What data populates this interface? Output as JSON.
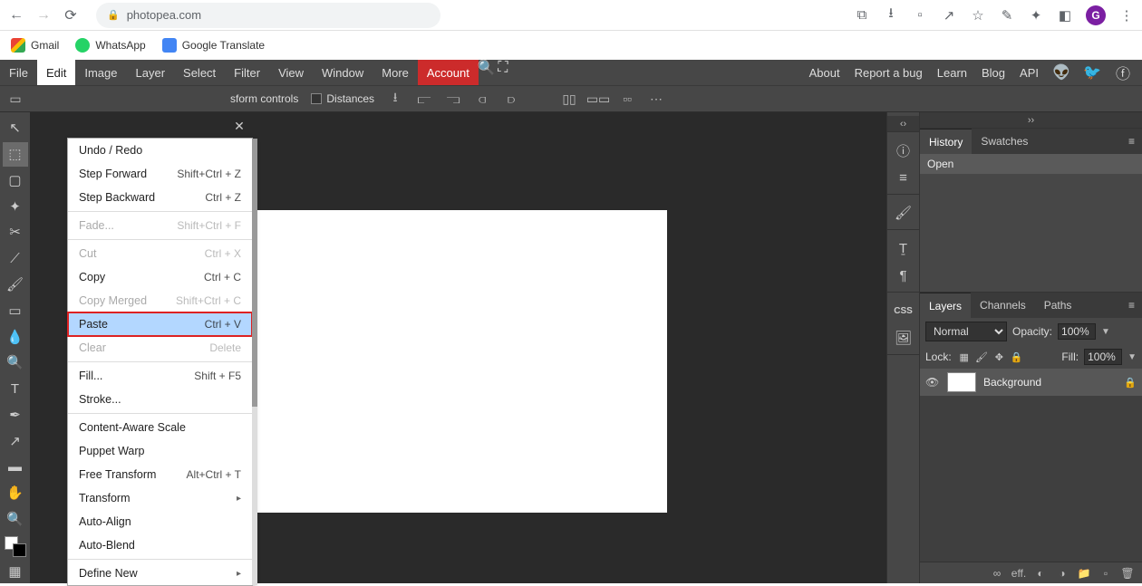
{
  "browser": {
    "url": "photopea.com",
    "avatar_letter": "G",
    "bookmarks": [
      {
        "label": "Gmail"
      },
      {
        "label": "WhatsApp"
      },
      {
        "label": "Google Translate"
      }
    ]
  },
  "menubar": {
    "items": [
      "File",
      "Edit",
      "Image",
      "Layer",
      "Select",
      "Filter",
      "View",
      "Window",
      "More"
    ],
    "account": "Account",
    "right": [
      "About",
      "Report a bug",
      "Learn",
      "Blog",
      "API"
    ]
  },
  "options_bar": {
    "transform": "sform controls",
    "distances": "Distances"
  },
  "edit_menu": {
    "items": [
      {
        "label": "Undo / Redo",
        "kb": "",
        "type": "item"
      },
      {
        "label": "Step Forward",
        "kb": "Shift+Ctrl + Z",
        "type": "item"
      },
      {
        "label": "Step Backward",
        "kb": "Ctrl + Z",
        "type": "item"
      },
      {
        "type": "sep"
      },
      {
        "label": "Fade...",
        "kb": "Shift+Ctrl + F",
        "type": "item",
        "disabled": true
      },
      {
        "type": "sep"
      },
      {
        "label": "Cut",
        "kb": "Ctrl + X",
        "type": "item",
        "disabled": true
      },
      {
        "label": "Copy",
        "kb": "Ctrl + C",
        "type": "item"
      },
      {
        "label": "Copy Merged",
        "kb": "Shift+Ctrl + C",
        "type": "item",
        "disabled": true
      },
      {
        "label": "Paste",
        "kb": "Ctrl + V",
        "type": "item",
        "highlight": true
      },
      {
        "label": "Clear",
        "kb": "Delete",
        "type": "item",
        "disabled": true
      },
      {
        "type": "sep"
      },
      {
        "label": "Fill...",
        "kb": "Shift + F5",
        "type": "item"
      },
      {
        "label": "Stroke...",
        "kb": "",
        "type": "item"
      },
      {
        "type": "sep"
      },
      {
        "label": "Content-Aware Scale",
        "kb": "",
        "type": "item"
      },
      {
        "label": "Puppet Warp",
        "kb": "",
        "type": "item"
      },
      {
        "label": "Free Transform",
        "kb": "Alt+Ctrl + T",
        "type": "item"
      },
      {
        "label": "Transform",
        "kb": "",
        "type": "sub"
      },
      {
        "label": "Auto-Align",
        "kb": "",
        "type": "item"
      },
      {
        "label": "Auto-Blend",
        "kb": "",
        "type": "item"
      },
      {
        "type": "sep"
      },
      {
        "label": "Define New",
        "kb": "",
        "type": "sub"
      }
    ]
  },
  "panels": {
    "history": {
      "tabs": [
        "History",
        "Swatches"
      ],
      "item": "Open"
    },
    "layers": {
      "tabs": [
        "Layers",
        "Channels",
        "Paths"
      ],
      "blend_mode": "Normal",
      "opacity_label": "Opacity:",
      "opacity_val": "100%",
      "lock_label": "Lock:",
      "fill_label": "Fill:",
      "fill_val": "100%",
      "layer_name": "Background"
    },
    "footer_eff": "eff."
  }
}
